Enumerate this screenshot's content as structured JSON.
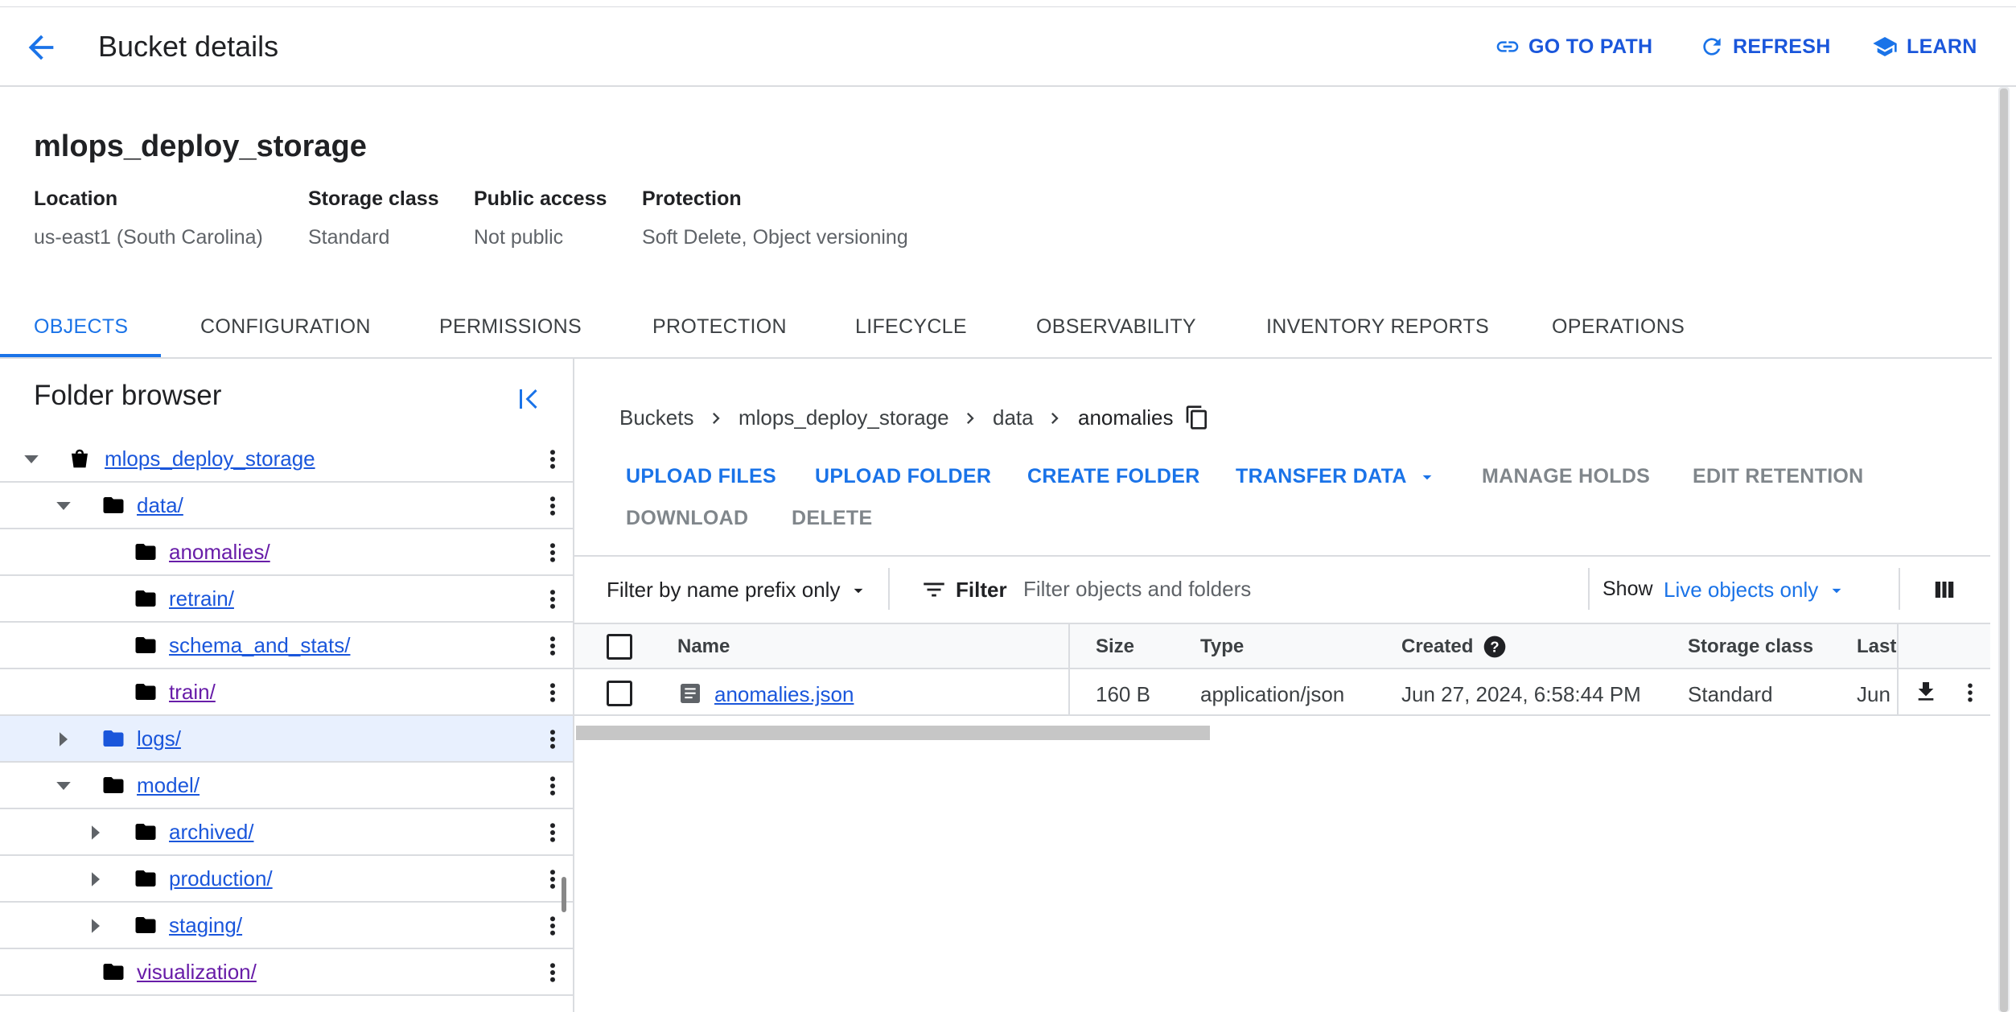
{
  "header": {
    "title": "Bucket details",
    "go_to_path": "GO TO PATH",
    "refresh": "REFRESH",
    "learn": "LEARN"
  },
  "bucket": {
    "name": "mlops_deploy_storage",
    "location_label": "Location",
    "location_value": "us-east1 (South Carolina)",
    "storage_class_label": "Storage class",
    "storage_class_value": "Standard",
    "public_access_label": "Public access",
    "public_access_value": "Not public",
    "protection_label": "Protection",
    "protection_value": "Soft Delete, Object versioning"
  },
  "tabs": [
    {
      "label": "OBJECTS",
      "active": true
    },
    {
      "label": "CONFIGURATION"
    },
    {
      "label": "PERMISSIONS"
    },
    {
      "label": "PROTECTION"
    },
    {
      "label": "LIFECYCLE"
    },
    {
      "label": "OBSERVABILITY"
    },
    {
      "label": "INVENTORY REPORTS"
    },
    {
      "label": "OPERATIONS"
    }
  ],
  "folder_browser": {
    "title": "Folder browser",
    "items": [
      {
        "label": "mlops_deploy_storage",
        "icon": "bucket-icon",
        "caret": "expanded"
      },
      {
        "label": "data/",
        "icon": "folder-icon",
        "caret": "expanded"
      },
      {
        "label": "anomalies/",
        "icon": "folder-icon",
        "visited": true
      },
      {
        "label": "retrain/",
        "icon": "folder-icon"
      },
      {
        "label": "schema_and_stats/",
        "icon": "folder-icon"
      },
      {
        "label": "train/",
        "icon": "folder-icon",
        "visited": true
      },
      {
        "label": "logs/",
        "icon": "folder-icon",
        "caret": "collapsed",
        "selected": true
      },
      {
        "label": "model/",
        "icon": "folder-icon",
        "caret": "expanded"
      },
      {
        "label": "archived/",
        "icon": "folder-icon",
        "caret": "collapsed"
      },
      {
        "label": "production/",
        "icon": "folder-icon",
        "caret": "collapsed"
      },
      {
        "label": "staging/",
        "icon": "folder-icon",
        "caret": "collapsed"
      },
      {
        "label": "visualization/",
        "icon": "folder-icon",
        "visited": true
      }
    ]
  },
  "breadcrumb": [
    "Buckets",
    "mlops_deploy_storage",
    "data",
    "anomalies"
  ],
  "actions": {
    "upload_files": "UPLOAD FILES",
    "upload_folder": "UPLOAD FOLDER",
    "create_folder": "CREATE FOLDER",
    "transfer_data": "TRANSFER DATA",
    "manage_holds": "MANAGE HOLDS",
    "edit_retention": "EDIT RETENTION",
    "download": "DOWNLOAD",
    "delete": "DELETE"
  },
  "filter": {
    "prefix_mode": "Filter by name prefix only",
    "label": "Filter",
    "placeholder": "Filter objects and folders",
    "show_label": "Show",
    "show_value": "Live objects only"
  },
  "table": {
    "columns": [
      "Name",
      "Size",
      "Type",
      "Created",
      "Storage class",
      "Last"
    ],
    "rows": [
      {
        "name": "anomalies.json",
        "size": "160 B",
        "type": "application/json",
        "created": "Jun 27, 2024, 6:58:44 PM",
        "storage_class": "Standard",
        "last": "Jun"
      }
    ]
  },
  "colors": {
    "accent": "#1a73e8",
    "link": "#1a56db",
    "visited_link": "#681da8",
    "selected_row": "#e8f0fe"
  }
}
